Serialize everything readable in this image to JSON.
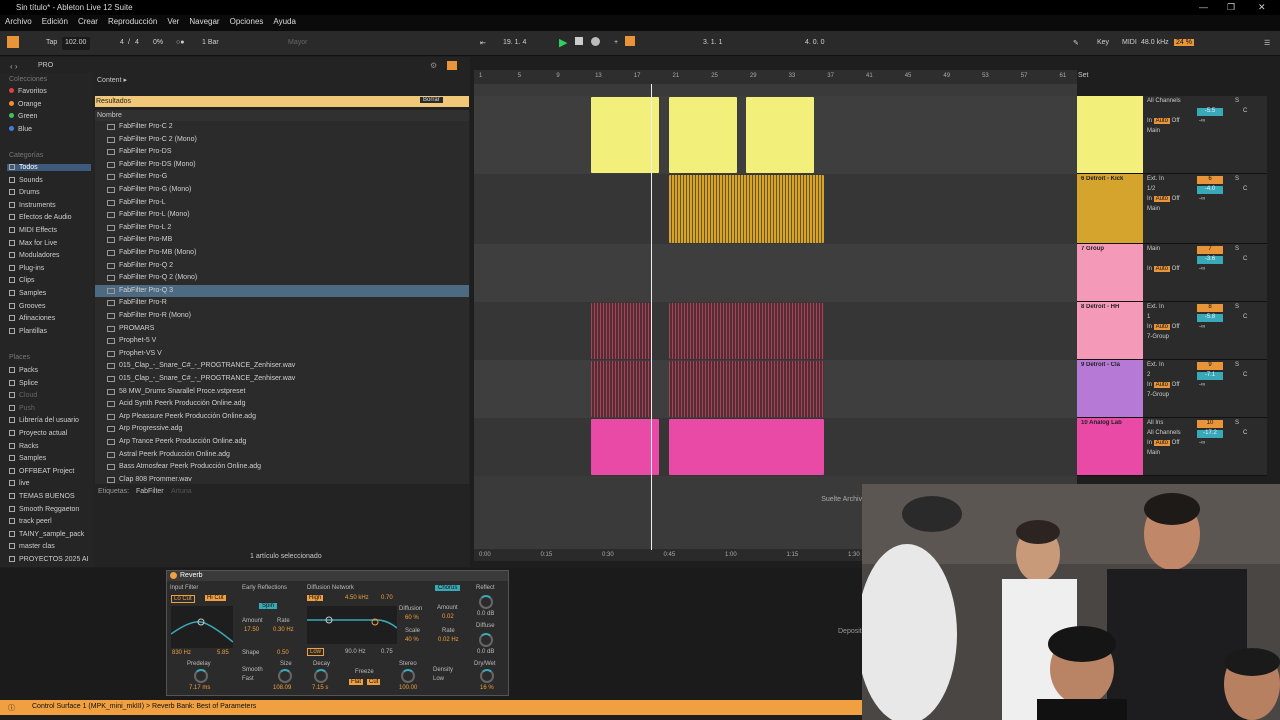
{
  "window": {
    "title": "Sin título* - Ableton Live 12 Suite"
  },
  "menu": [
    "Archivo",
    "Edición",
    "Crear",
    "Reproducción",
    "Ver",
    "Navegar",
    "Opciones",
    "Ayuda"
  ],
  "transport": {
    "tap": "Tap",
    "tempo": "102.00",
    "time_sig_num": "4",
    "time_sig_den": "4",
    "groove": "0%",
    "quantize": "1 Bar",
    "scale_mode": "Mayor",
    "position": "19. 1. 4",
    "loop_start": "3. 1. 1",
    "loop_length": "4. 0. 0",
    "key_label": "Key",
    "midi_label": "MIDI",
    "sample_rate": "48.0 kHz",
    "cpu": "24 %"
  },
  "browser": {
    "breadcrumb": "PRO",
    "content_label": "Content ▸",
    "colecciones_label": "Colecciones",
    "colecciones": [
      {
        "label": "Favoritos",
        "color": "#e04040"
      },
      {
        "label": "Orange",
        "color": "#f09030"
      },
      {
        "label": "Green",
        "color": "#40c060"
      },
      {
        "label": "Blue",
        "color": "#4080e0"
      }
    ],
    "categorias_label": "Categorías",
    "categorias": [
      "Todos",
      "Sounds",
      "Drums",
      "Instruments",
      "Efectos de Audio",
      "MIDI Effects",
      "Max for Live",
      "Moduladores",
      "Plug-ins",
      "Clips",
      "Samples",
      "Grooves",
      "Afinaciones",
      "Plantillas"
    ],
    "places_label": "Places",
    "places": [
      "Packs",
      "Splice",
      "Cloud",
      "Push",
      "Librería del usuario",
      "Proyecto actual",
      "Racks",
      "Samples",
      "OFFBEAT Project",
      "live",
      "TEMAS BUENOS",
      "Smooth Reggaeton",
      "track peerl",
      "TAINY_sample_pack",
      "master clas",
      "PROYECTOS 2025 AI"
    ],
    "results_label": "Resultados",
    "clear_button": "Borrar",
    "column_name": "Nombre",
    "items": [
      "FabFilter Pro-C 2",
      "FabFilter Pro-C 2 (Mono)",
      "FabFilter Pro-DS",
      "FabFilter Pro-DS (Mono)",
      "FabFilter Pro-G",
      "FabFilter Pro-G (Mono)",
      "FabFilter Pro-L",
      "FabFilter Pro-L (Mono)",
      "FabFilter Pro-L 2",
      "FabFilter Pro-MB",
      "FabFilter Pro-MB (Mono)",
      "FabFilter Pro-Q 2",
      "FabFilter Pro-Q 2 (Mono)",
      "FabFilter Pro-Q 3",
      "FabFilter Pro-R",
      "FabFilter Pro-R (Mono)",
      "PROMARS",
      "Prophet-5 V",
      "Prophet-VS V",
      "015_Clap_-_Snare_C#_-_PROGTRANCE_Zenhiser.wav",
      "015_Clap_-_Snare_C#_-_PROGTRANCE_Zenhiser.wav",
      "58 MW_Drums Snarallel Proce.vstpreset",
      "Acid Synth Peerk Producción Online.adg",
      "Arp Pleassure Peerk Producción Online.adg",
      "Arp Progressive.adg",
      "Arp Trance Peerk Producción Online.adg",
      "Astral Peerk Producción Online.adg",
      "Bass Atmosfear Peerk Producción Online.adg",
      "Clap 808 Prommer.wav"
    ],
    "selected_index": 13,
    "tags_label": "Etiquetas:",
    "tag": "FabFilter",
    "tag2": "Arturia",
    "selection_status": "1 artículo seleccionado"
  },
  "arrangement": {
    "ruler": [
      "1",
      "5",
      "9",
      "13",
      "17",
      "21",
      "25",
      "29",
      "33",
      "37",
      "41",
      "45",
      "49",
      "53",
      "57",
      "61"
    ],
    "time_ruler": [
      "0:00",
      "0:15",
      "0:30",
      "0:45",
      "1:00",
      "1:15",
      "1:30"
    ],
    "set_label": "Set",
    "drop_hint": "Suelte Archivos y Dispositivos aquí",
    "tracks": [
      {
        "name": "",
        "input": "All Channels",
        "num": "",
        "vol": "-5.5",
        "route": "Main",
        "color": "#f2f07a",
        "height": 78
      },
      {
        "name": "6 Detroit - Kick",
        "input": "Ext. In",
        "sub": "1/2",
        "num": "6",
        "vol": "-4.0",
        "route": "Main",
        "color": "#d4a42c",
        "height": 70
      },
      {
        "name": "7 Group",
        "input": "Main",
        "num": "7",
        "vol": "-3.6",
        "route": "",
        "color": "#f49ab8",
        "height": 58
      },
      {
        "name": "8 Detroit - HH",
        "input": "Ext. In",
        "sub": "1",
        "num": "8",
        "vol": "-5.8",
        "route": "7-Group",
        "color": "#f49ab8",
        "height": 58
      },
      {
        "name": "9 Detroit - Cla",
        "input": "Ext. In",
        "sub": "2",
        "num": "9",
        "vol": "-7.1",
        "route": "7-Group",
        "color": "#b67ad6",
        "height": 58
      },
      {
        "name": "10 Analog Lab",
        "input": "All Ins",
        "sub": "All Channels",
        "num": "10",
        "vol": "-17.2",
        "route": "Main",
        "color": "#e84aa6",
        "height": 58
      }
    ],
    "in_label": "In",
    "auto_label": "Auto",
    "off_label": "Off",
    "s_label": "S",
    "c_label": "C",
    "inf_label": "-∞"
  },
  "device": {
    "name": "Reverb",
    "input_filter": "Input Filter",
    "locut": "Lo Cut",
    "hicut": "Hi Cut",
    "freq": "830 Hz",
    "width": "5.85",
    "early": "Early Reflections",
    "spin": "Spin",
    "amount_label": "Amount",
    "rate_label": "Rate",
    "er_amount": "17.50",
    "er_rate": "0.30 Hz",
    "shape_label": "Shape",
    "shape": "0.50",
    "diffusion": "Diffusion Network",
    "high": "High",
    "high_freq": "4.50 kHz",
    "high_val": "0.70",
    "diffusion_label": "Diffusion",
    "diffusion_val": "60 %",
    "scale_label": "Scale",
    "scale_val": "40 %",
    "low": "Low",
    "low_freq": "90.0 Hz",
    "low_val": "0.75",
    "chorus": "Chorus",
    "ch_amount": "0.02",
    "ch_rate": "0.02 Hz",
    "reflect": "Reflect",
    "reflect_val": "0.0 dB",
    "diffuse": "Diffuse",
    "diffuse_val": "0.0 dB",
    "predelay": "Predelay",
    "predelay_val": "7.17 ms",
    "smooth": "Smooth",
    "smooth_val": "Fast",
    "size": "Size",
    "size_val": "108.09",
    "decay": "Decay",
    "decay_val": "7.15 s",
    "freeze": "Freeze",
    "flat": "Flat",
    "cut": "Cut",
    "stereo": "Stereo",
    "stereo_val": "100.00",
    "density": "Density",
    "density_val": "Low",
    "drywet": "Dry/Wet",
    "drywet_val": "16 %",
    "deposit": "Deposit"
  },
  "status": "Control Surface 1 (MPK_mini_mkIII) > Reverb Bank: Best of Parameters"
}
